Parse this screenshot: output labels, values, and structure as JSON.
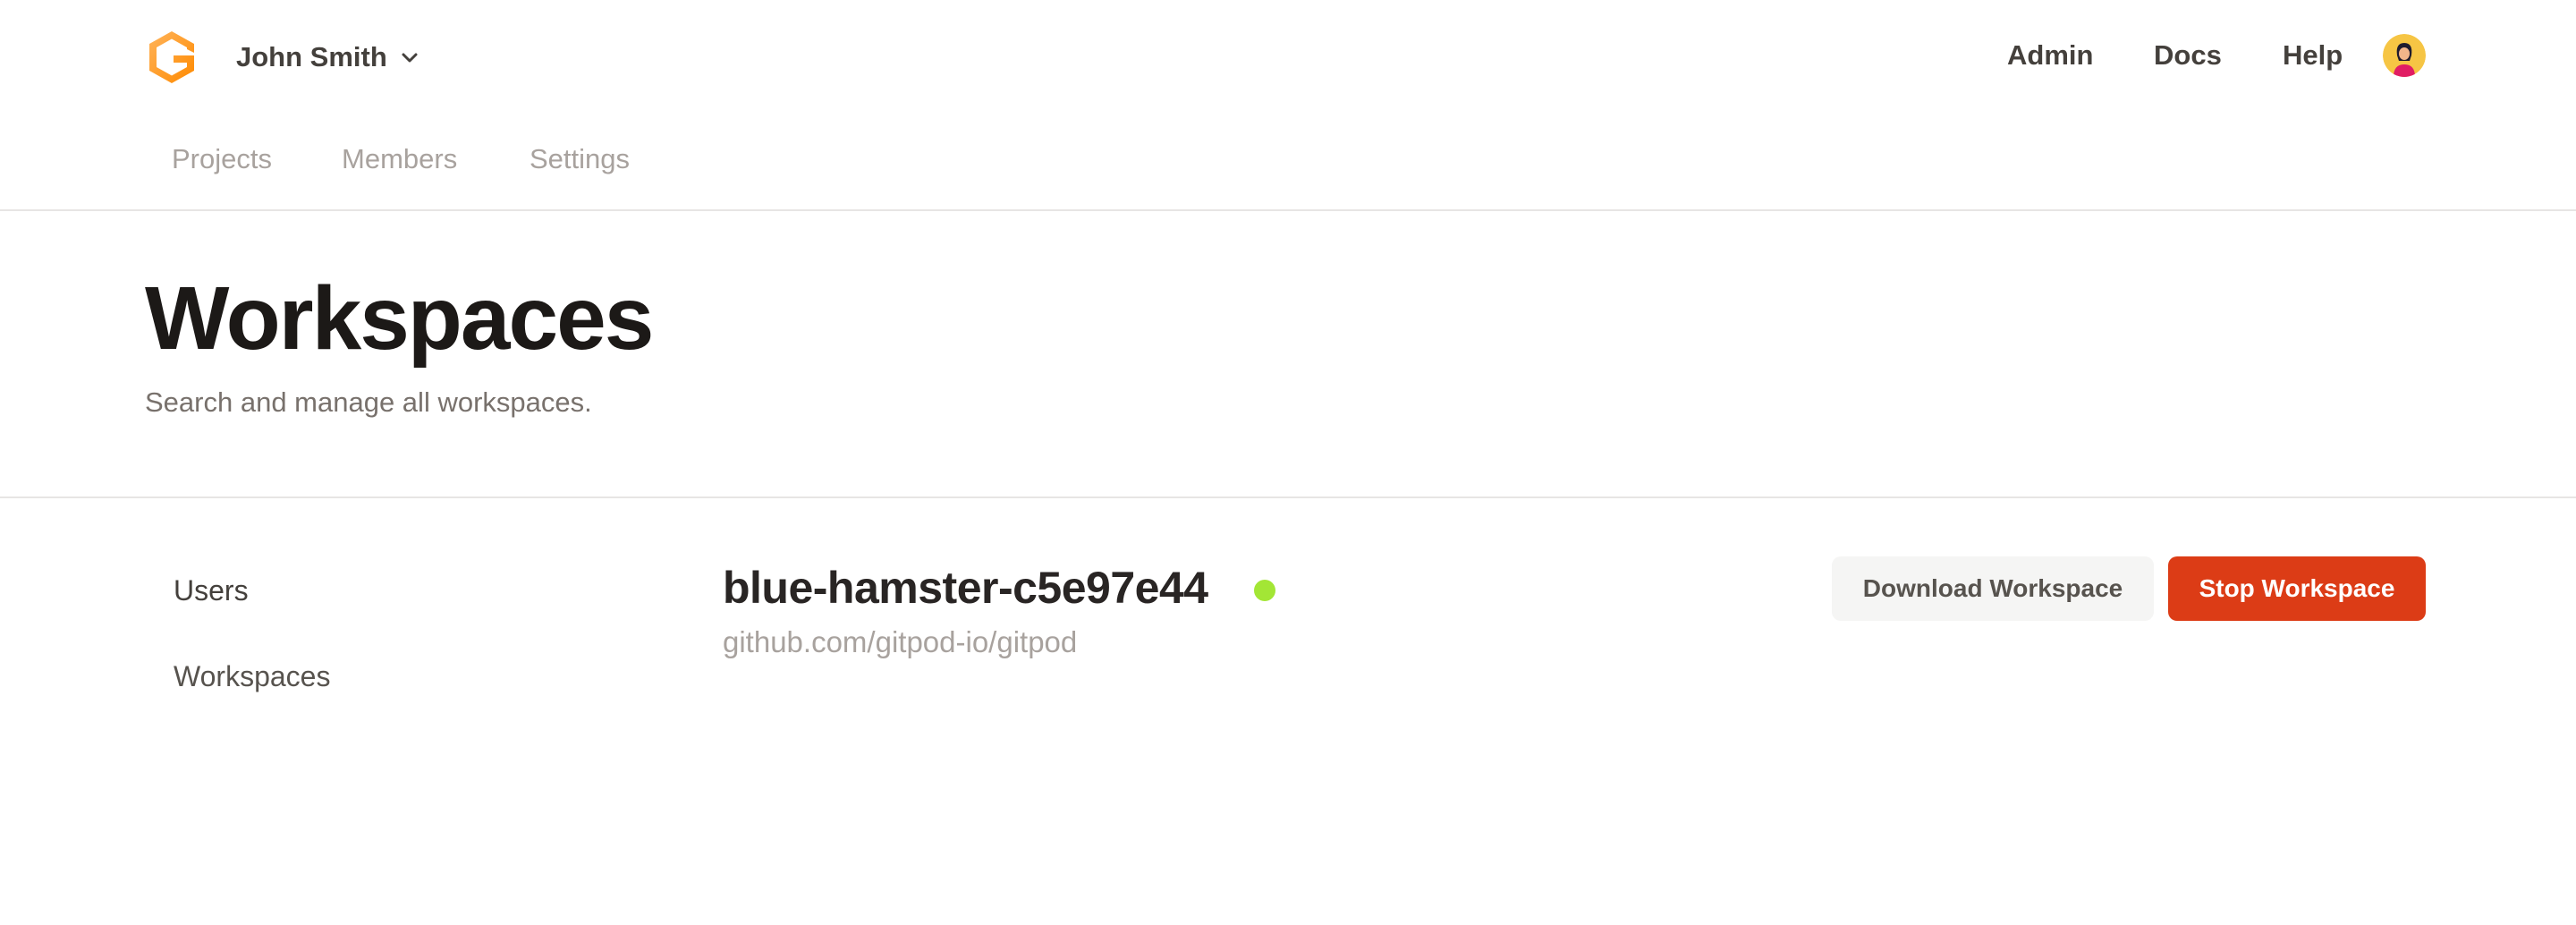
{
  "header": {
    "org_name": "John Smith",
    "nav": [
      "Admin",
      "Docs",
      "Help"
    ]
  },
  "subnav": {
    "tabs": [
      "Projects",
      "Members",
      "Settings"
    ]
  },
  "page": {
    "title": "Workspaces",
    "subtitle": "Search and manage all workspaces."
  },
  "sidebar": {
    "items": [
      {
        "label": "Users"
      },
      {
        "label": "Workspaces"
      }
    ]
  },
  "workspace": {
    "name": "blue-hamster-c5e97e44",
    "repo": "github.com/gitpod-io/gitpod",
    "status_color": "#a3e635"
  },
  "actions": {
    "download_label": "Download Workspace",
    "stop_label": "Stop Workspace"
  },
  "colors": {
    "brand_orange": "#ff8a00",
    "danger": "#dc3c16"
  },
  "icons": {
    "logo": "gitpod-logo-icon",
    "org_chevron": "chevron-down-icon",
    "avatar": "user-avatar"
  }
}
